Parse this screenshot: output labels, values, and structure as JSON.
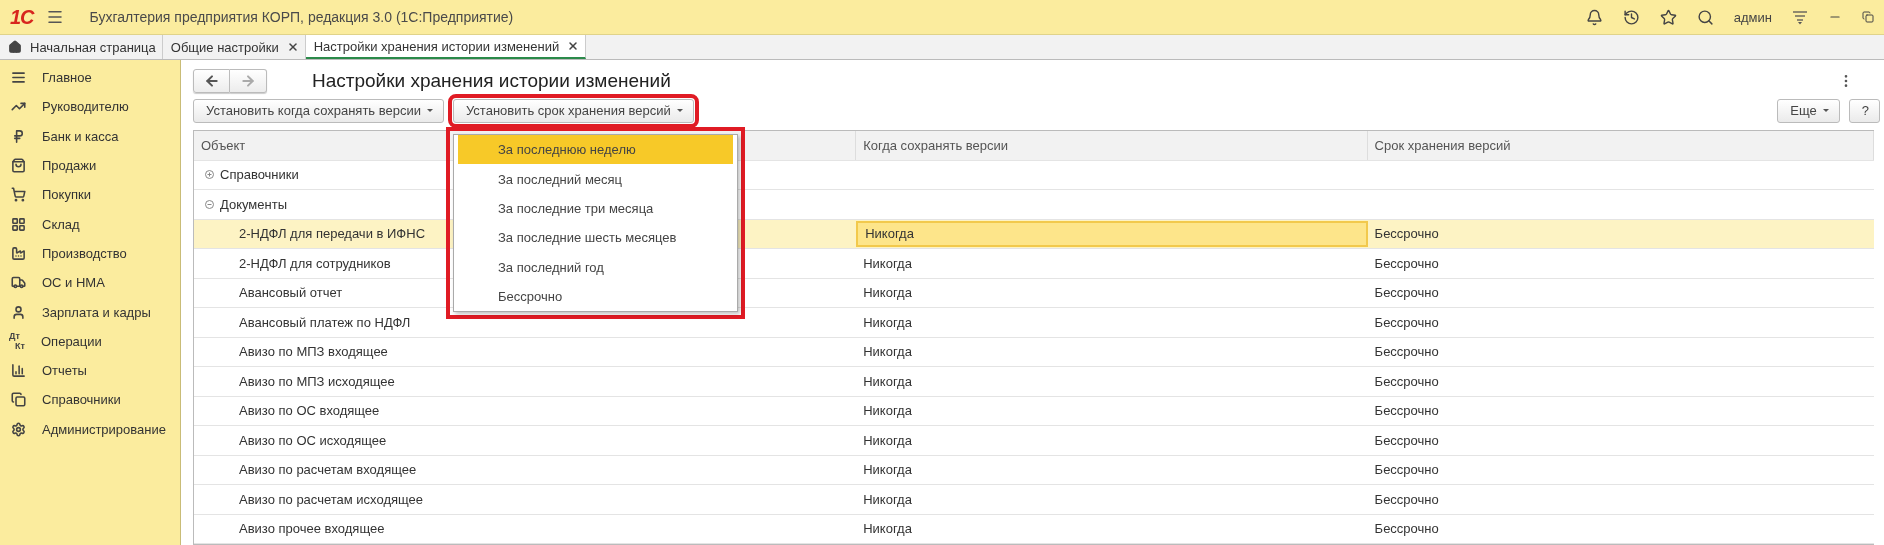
{
  "app_bar": {
    "logo": "1С",
    "title": "Бухгалтерия предприятия КОРП, редакция 3.0  (1С:Предприятие)",
    "user": "админ"
  },
  "tabs": [
    {
      "label": "Начальная страница",
      "kind": "home",
      "selected": false
    },
    {
      "label": "Общие настройки",
      "kind": "closable",
      "selected": false
    },
    {
      "label": "Настройки хранения истории изменений",
      "kind": "closable",
      "selected": true
    }
  ],
  "sidebar": {
    "items": [
      {
        "label": "Главное",
        "kind": "icon"
      },
      {
        "label": "Руководителю",
        "kind": "icon"
      },
      {
        "label": "Банк и касса",
        "kind": "icon"
      },
      {
        "label": "Продажи",
        "kind": "icon"
      },
      {
        "label": "Покупки",
        "kind": "icon"
      },
      {
        "label": "Склад",
        "kind": "icon"
      },
      {
        "label": "Производство",
        "kind": "icon"
      },
      {
        "label": "ОС и НМА",
        "kind": "icon"
      },
      {
        "label": "Зарплата и кадры",
        "kind": "icon"
      },
      {
        "label": "Операции",
        "kind": "text-icon",
        "icon_top": "Дт",
        "icon_bottom": "Кт"
      },
      {
        "label": "Отчеты",
        "kind": "icon"
      },
      {
        "label": "Справочники",
        "kind": "icon"
      },
      {
        "label": "Администрирование",
        "kind": "icon"
      }
    ]
  },
  "form": {
    "title": "Настройки хранения истории изменений",
    "toolbar": [
      {
        "label": "Установить когда сохранять версии",
        "highlighted": false
      },
      {
        "label": "Установить срок хранения версий",
        "highlighted": true
      }
    ],
    "more_button": "Еще",
    "help_button": "?",
    "dropdown": {
      "highlighted": true,
      "items": [
        {
          "label": "За последнюю неделю",
          "selected": true
        },
        {
          "label": "За последний месяц",
          "selected": false
        },
        {
          "label": "За последние три месяца",
          "selected": false
        },
        {
          "label": "За последние шесть месяцев",
          "selected": false
        },
        {
          "label": "За последний год",
          "selected": false
        },
        {
          "label": "Бессрочно",
          "selected": false
        }
      ]
    },
    "table": {
      "columns": [
        "Объект",
        "Когда сохранять версии",
        "Срок хранения версий"
      ],
      "rows": [
        {
          "object": "Справочники",
          "expanded": false,
          "selected": false
        },
        {
          "object": "Документы",
          "expanded": true,
          "selected": false,
          "children": [
            {
              "object": "2-НДФЛ для передачи в ИФНС",
              "when": "Никогда",
              "term": "Бессрочно",
              "selected": true
            },
            {
              "object": "2-НДФЛ для сотрудников",
              "when": "Никогда",
              "term": "Бессрочно",
              "selected": false
            },
            {
              "object": "Авансовый отчет",
              "when": "Никогда",
              "term": "Бессрочно",
              "selected": false
            },
            {
              "object": "Авансовый платеж по НДФЛ",
              "when": "Никогда",
              "term": "Бессрочно",
              "selected": false
            },
            {
              "object": "Авизо по МПЗ входящее",
              "when": "Никогда",
              "term": "Бессрочно",
              "selected": false
            },
            {
              "object": "Авизо по МПЗ исходящее",
              "when": "Никогда",
              "term": "Бессрочно",
              "selected": false
            },
            {
              "object": "Авизо по ОС входящее",
              "when": "Никогда",
              "term": "Бессрочно",
              "selected": false
            },
            {
              "object": "Авизо по ОС исходящее",
              "when": "Никогда",
              "term": "Бессрочно",
              "selected": false
            },
            {
              "object": "Авизо по расчетам входящее",
              "when": "Никогда",
              "term": "Бессрочно",
              "selected": false
            },
            {
              "object": "Авизо по расчетам исходящее",
              "when": "Никогда",
              "term": "Бессрочно",
              "selected": false
            },
            {
              "object": "Авизо прочее входящее",
              "when": "Никогда",
              "term": "Бессрочно",
              "selected": false
            }
          ]
        }
      ]
    }
  }
}
